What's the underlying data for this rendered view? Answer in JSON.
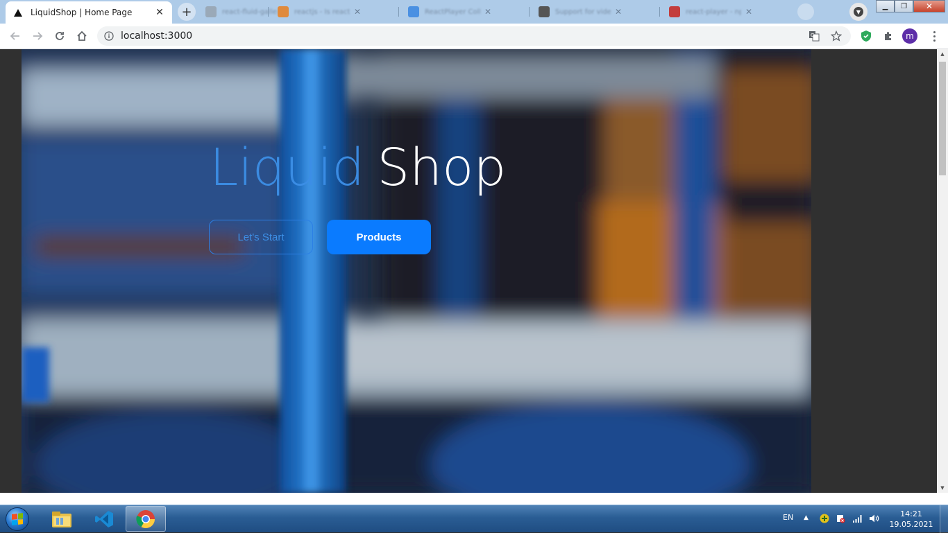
{
  "browser": {
    "active_tab": {
      "title": "LiquidShop | Home Page",
      "favicon": "triangle-icon"
    },
    "background_tabs": [
      {
        "title": "react-fluid-gallery",
        "favicon_color": "#9a9a9a"
      },
      {
        "title": "reactjs - Is react-player",
        "favicon_color": "#e08a3c"
      },
      {
        "title": "ReactPlayer Collection",
        "favicon_color": "#4a90e2"
      },
      {
        "title": "Support for video inside",
        "favicon_color": "#555555"
      },
      {
        "title": "react-player - npm",
        "favicon_color": "#c33d3d"
      }
    ],
    "url": "localhost:3000",
    "profile_initial": "m",
    "accent_color": "#5d2ea8"
  },
  "page": {
    "brand_part1": "Liquid",
    "brand_part2": "Shop",
    "buttons": {
      "start_label": "Let's Start",
      "products_label": "Products"
    },
    "colors": {
      "brand_blue": "#3d8fe6",
      "button_blue": "#0a7bff"
    }
  },
  "taskbar": {
    "language": "EN",
    "time": "14:21",
    "date": "19.05.2021"
  }
}
